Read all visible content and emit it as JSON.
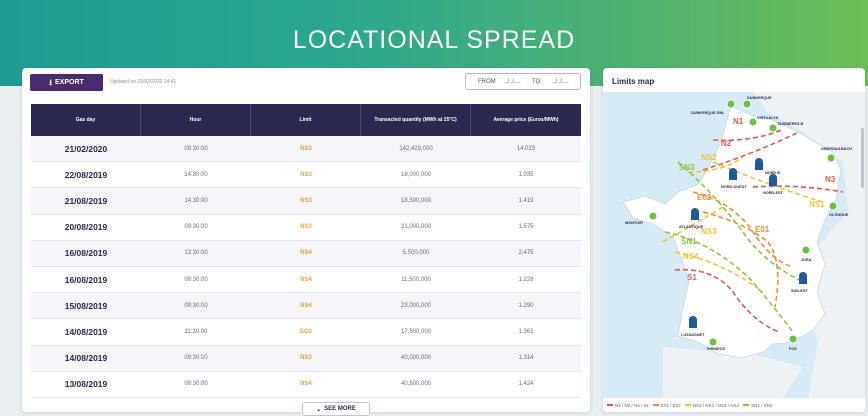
{
  "page": {
    "title": "LOCATIONAL SPREAD"
  },
  "toolbar": {
    "export_label": "EXPORT",
    "updated_text": "Updated on 21/02/2020 14:41",
    "from_label": "FROM",
    "from_value": "../../....",
    "to_label": "TO",
    "to_value": "../../...."
  },
  "table": {
    "columns": [
      "Gas day",
      "Hour",
      "Limit",
      "Transacted quantity (MWh at 25°C)",
      "Average price (Euros/MWh)"
    ],
    "rows": [
      {
        "gas_day": "21/02/2020",
        "hour": "09:30:00",
        "limit": "NS3",
        "quantity": "142,429,000",
        "price": "14.029"
      },
      {
        "gas_day": "22/08/2019",
        "hour": "14:30:00",
        "limit": "NS3",
        "quantity": "18,000,000",
        "price": "1.035"
      },
      {
        "gas_day": "21/08/2019",
        "hour": "14:30:00",
        "limit": "NS3",
        "quantity": "18,500,000",
        "price": "1.419"
      },
      {
        "gas_day": "20/08/2019",
        "hour": "09:30:00",
        "limit": "NS3",
        "quantity": "31,000,000",
        "price": "1.575"
      },
      {
        "gas_day": "16/08/2019",
        "hour": "13:30:00",
        "limit": "NS4",
        "quantity": "5,500,000",
        "price": "2.475"
      },
      {
        "gas_day": "16/08/2019",
        "hour": "09:30:00",
        "limit": "NS4",
        "quantity": "11,500,000",
        "price": "1.228"
      },
      {
        "gas_day": "15/08/2019",
        "hour": "09:30:00",
        "limit": "NS4",
        "quantity": "23,000,000",
        "price": "1.290"
      },
      {
        "gas_day": "14/08/2019",
        "hour": "11:30:00",
        "limit": "EO2",
        "quantity": "17,500,000",
        "price": "1.362"
      },
      {
        "gas_day": "14/08/2019",
        "hour": "09:30:00",
        "limit": "NS3",
        "quantity": "40,000,000",
        "price": "1.314"
      },
      {
        "gas_day": "13/08/2019",
        "hour": "09:30:00",
        "limit": "NS4",
        "quantity": "40,500,000",
        "price": "1.424"
      }
    ],
    "see_more_label": "SEE MORE"
  },
  "map": {
    "title": "Limits map",
    "labels": {
      "n1": "N1",
      "n2": "N2",
      "n3": "N3",
      "ns1": "NS1",
      "ns2": "NS2",
      "ns3": "NS3",
      "ns4": "NS4",
      "sn1": "SN1",
      "sn3": "SN3",
      "s1": "S1",
      "e01": "E01",
      "e02": "E02"
    },
    "places": {
      "dunkerque_gnl": "DUNKERQUE GNL",
      "dunkerque": "DUNKERQUE",
      "virtualys": "VIRTUALYS",
      "taisnieres": "TAISNIÈRES B",
      "obergailbach": "OBERGAILBACH",
      "nord_b": "NORD B",
      "nord_ouest": "NORD-OUEST",
      "nord_est": "NORD-EST",
      "oltingue": "OLTINGUE",
      "montoir": "MONTOIR",
      "atlantique": "ATLANTIQUE",
      "jura": "JURA",
      "sud_est": "SUD-EST",
      "lussagnet": "LUSSAGNET",
      "pirineos": "PIRINEOS",
      "fos": "FOS"
    },
    "legend": [
      {
        "label": "N1 / N2 / N3 / S1",
        "color": "#e05a4e"
      },
      {
        "label": "E01 / E02",
        "color": "#ef8a3a"
      },
      {
        "label": "NS1 / NS2 / NS3 / NS4",
        "color": "#f0c23a"
      },
      {
        "label": "SN1 / SN3",
        "color": "#8dc63f"
      }
    ],
    "colors": {
      "sea": "#d7ebf6",
      "land": "#ffffff",
      "neighbor": "#eef2f4",
      "red": "#e05a4e",
      "orange": "#ef8a3a",
      "yellow": "#f0c23a",
      "green": "#8dc63f",
      "point": "#6cbf3f",
      "station": "#1d5b9a",
      "navy": "#2c2950"
    }
  }
}
